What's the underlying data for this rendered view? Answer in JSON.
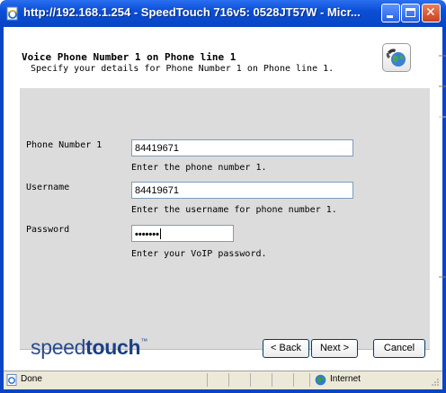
{
  "window": {
    "title": "http://192.168.1.254 - SpeedTouch 716v5: 0528JT57W - Micr...",
    "icon": "ie-page-icon",
    "buttons": [
      "minimize",
      "maximize",
      "close"
    ]
  },
  "header": {
    "title": "Voice Phone Number 1 on Phone line 1",
    "subtitle": "Specify your details for Phone Number 1 on Phone line 1.",
    "icon": "phone-globe-icon"
  },
  "form": {
    "phone_number": {
      "label": "Phone Number 1",
      "value": "84419671",
      "hint": "Enter the phone number 1."
    },
    "username": {
      "label": "Username",
      "value": "84419671",
      "hint": "Enter the username for phone number 1."
    },
    "password": {
      "label": "Password",
      "masked_value": "•••••••",
      "hint": "Enter your VoIP password."
    }
  },
  "footer": {
    "logo_light": "speed",
    "logo_bold": "touch",
    "logo_tm": "™",
    "back_label": "< Back",
    "next_label": "Next >",
    "cancel_label": "Cancel"
  },
  "statusbar": {
    "status": "Done",
    "zone": "Internet"
  },
  "colors": {
    "titlebar": "#0a4fd6",
    "panel": "#dcdcdc",
    "logo": "#1a3f86",
    "statusbar": "#ece9d8"
  }
}
